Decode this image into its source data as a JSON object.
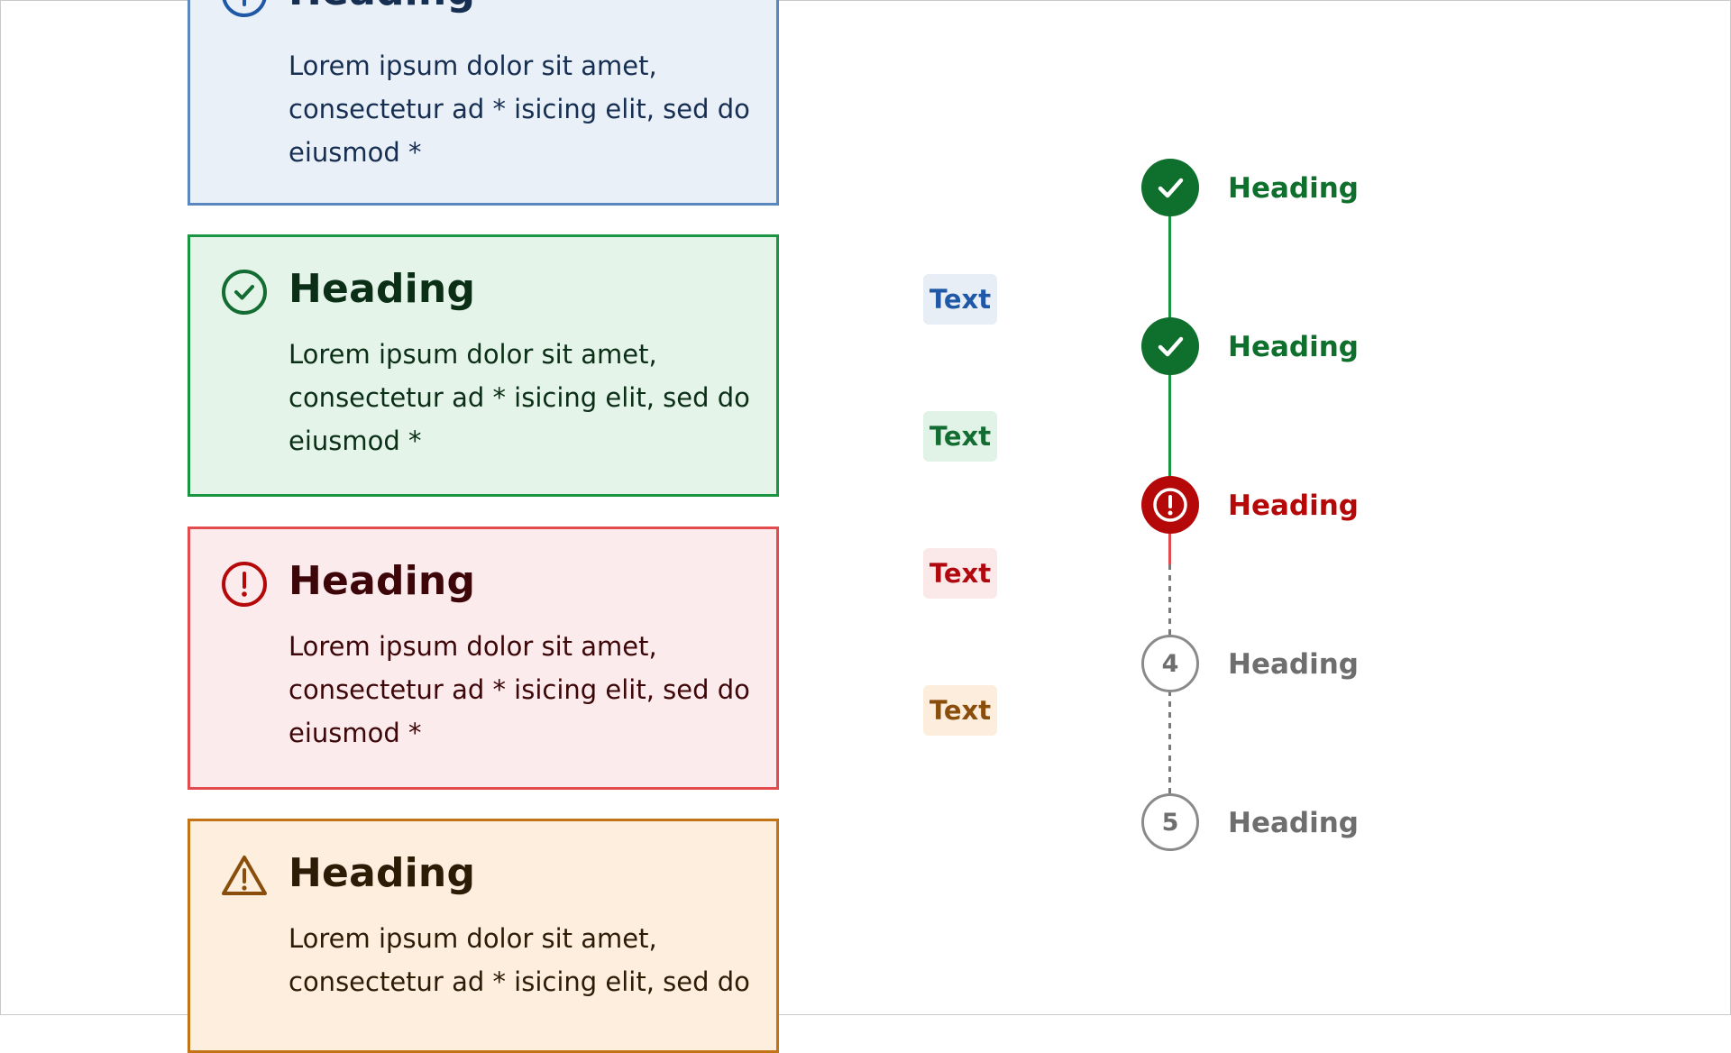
{
  "alerts": [
    {
      "variant": "info",
      "icon": "info-circle-icon",
      "heading": "Heading",
      "body": "Lorem ipsum dolor sit amet, consectetur ad * isicing elit, sed do eiusmod *"
    },
    {
      "variant": "success",
      "icon": "check-circle-icon",
      "heading": "Heading",
      "body": "Lorem ipsum dolor sit amet, consectetur ad * isicing elit, sed do eiusmod *"
    },
    {
      "variant": "error",
      "icon": "error-circle-icon",
      "heading": "Heading",
      "body": "Lorem ipsum dolor sit amet, consectetur ad * isicing elit, sed do eiusmod *"
    },
    {
      "variant": "warning",
      "icon": "warning-triangle-icon",
      "heading": "Heading",
      "body": "Lorem ipsum dolor sit amet, consectetur ad * isicing elit, sed do"
    }
  ],
  "tags": [
    {
      "label": "Text",
      "color": "#1e58a6"
    },
    {
      "label": "Text",
      "color": "#136c31"
    },
    {
      "label": "Text",
      "color": "#b0080f"
    },
    {
      "label": "Text",
      "color": "#8a4e0c"
    }
  ],
  "steps": [
    {
      "status": "complete",
      "icon": "check-icon",
      "label": "Heading",
      "color": "#0f6f2c"
    },
    {
      "status": "complete",
      "icon": "check-icon",
      "label": "Heading",
      "color": "#0f6f2c"
    },
    {
      "status": "error",
      "icon": "alert-icon",
      "label": "Heading",
      "color": "#b50909"
    },
    {
      "status": "incomplete",
      "number": "4",
      "label": "Heading",
      "color": "#6e6e6e"
    },
    {
      "status": "incomplete",
      "number": "5",
      "label": "Heading",
      "color": "#6e6e6e"
    }
  ],
  "colors": {
    "info_border": "#5a87bd",
    "success_border": "#1a9643",
    "error_border": "#e34c4f",
    "warning_border": "#c27315"
  }
}
